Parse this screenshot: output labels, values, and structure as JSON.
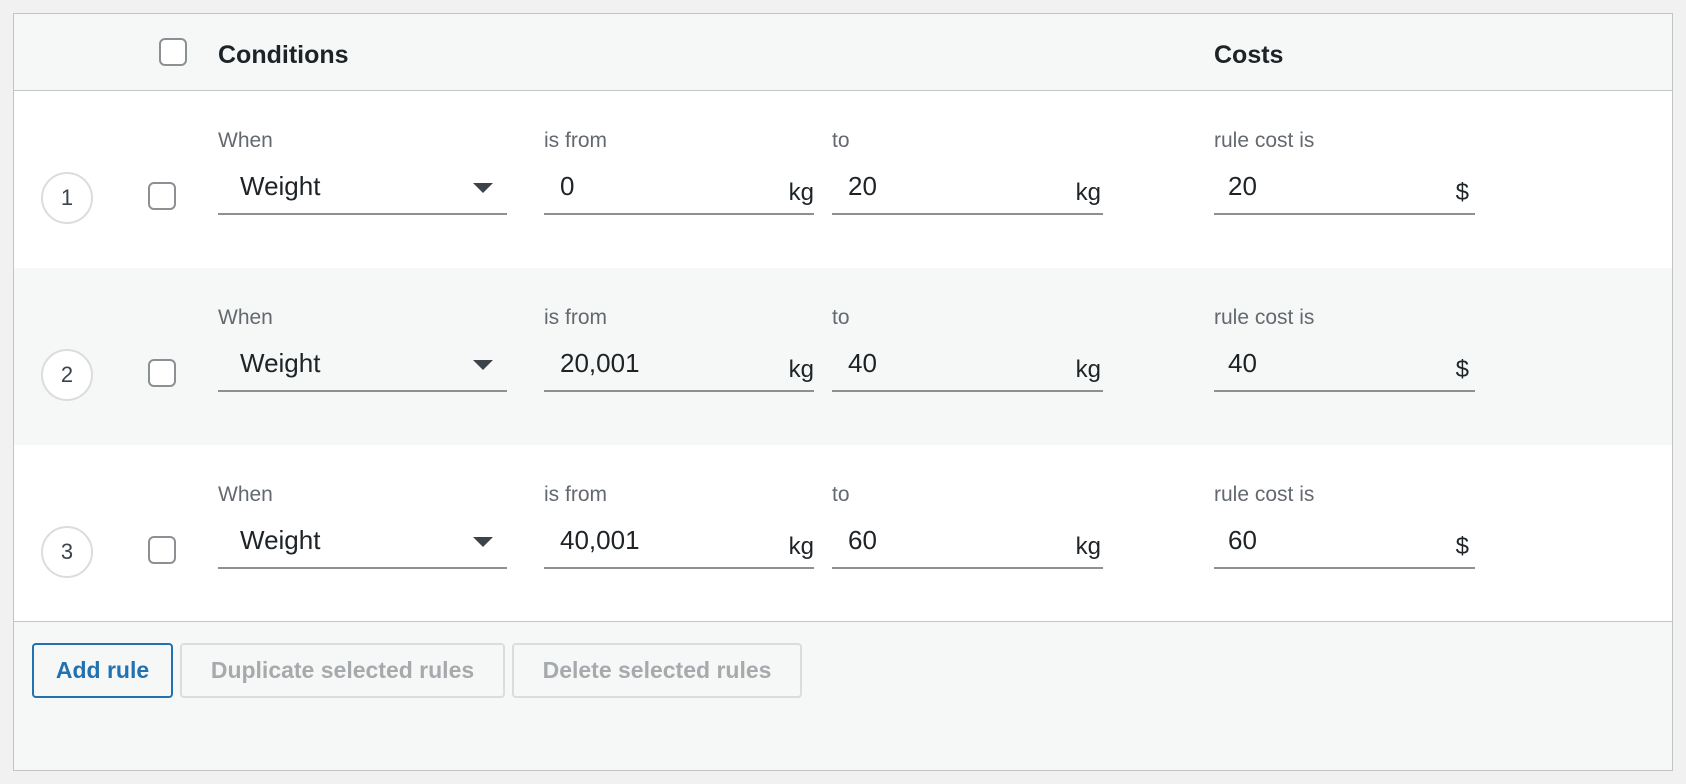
{
  "header": {
    "conditions": "Conditions",
    "costs": "Costs"
  },
  "labels": {
    "when": "When",
    "from": "is from",
    "to": "to",
    "cost": "rule cost is"
  },
  "rules": [
    {
      "number": "1",
      "condition": "Weight",
      "from": "0",
      "from_unit": "kg",
      "to": "20",
      "to_unit": "kg",
      "cost": "20",
      "currency": "$"
    },
    {
      "number": "2",
      "condition": "Weight",
      "from": "20,001",
      "from_unit": "kg",
      "to": "40",
      "to_unit": "kg",
      "cost": "40",
      "currency": "$"
    },
    {
      "number": "3",
      "condition": "Weight",
      "from": "40,001",
      "from_unit": "kg",
      "to": "60",
      "to_unit": "kg",
      "cost": "60",
      "currency": "$"
    }
  ],
  "footer": {
    "add_rule": "Add rule",
    "duplicate": "Duplicate selected rules",
    "delete": "Delete selected rules"
  },
  "colors": {
    "accent": "#2271b1",
    "border": "#c3c4c7",
    "alt_row": "#f6f7f7",
    "disabled_text": "#a7aaad"
  },
  "icons": {
    "dropdown": "chevron-down-icon",
    "checkbox": "checkbox-icon"
  }
}
